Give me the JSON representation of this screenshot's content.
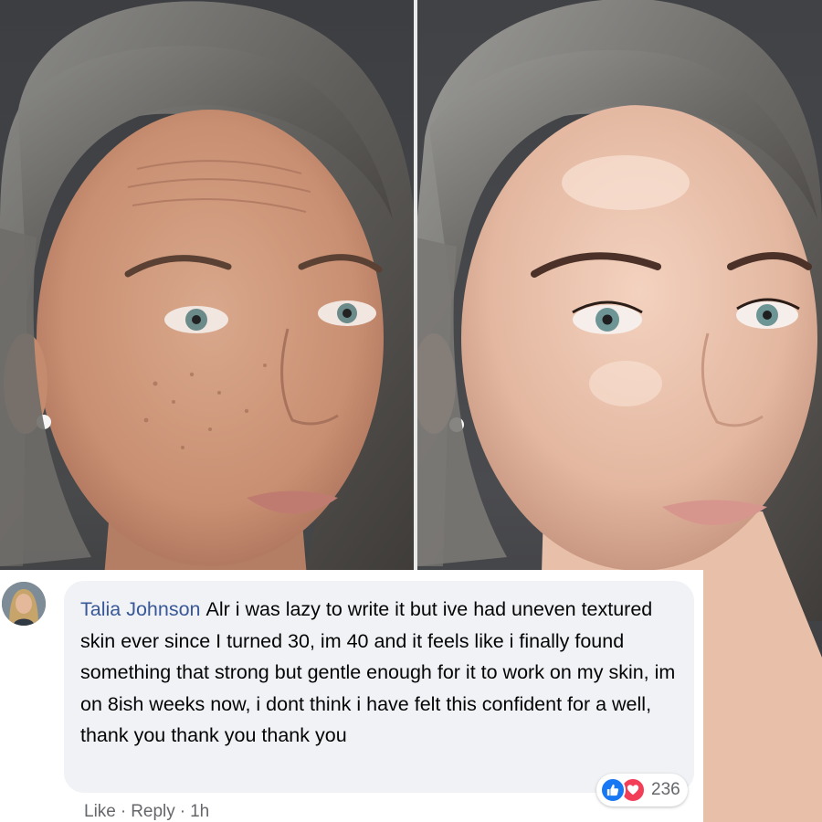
{
  "comment": {
    "author": "Talia Johnson",
    "text": "Alr i was lazy to write it but ive had uneven textured skin ever since I turned 30, im 40 and it feels like i finally found something that strong but gentle enough for it to work on my skin, im on 8ish weeks now, i dont think i have felt this confident for a well, thank you thank you thank you",
    "reactions": {
      "count": "236",
      "icons": [
        "thumbs-up-icon",
        "heart-icon"
      ],
      "colors": {
        "like": "#1877f2",
        "love": "#f33e58"
      }
    },
    "actions": {
      "like_label": "Like",
      "reply_label": "Reply",
      "separator": "·",
      "time": "1h"
    },
    "colors": {
      "author_name": "#385898",
      "bubble_bg": "#f0f2f5",
      "meta_text": "#65676b"
    }
  },
  "photos": {
    "left": "before-photo",
    "right": "after-photo"
  }
}
